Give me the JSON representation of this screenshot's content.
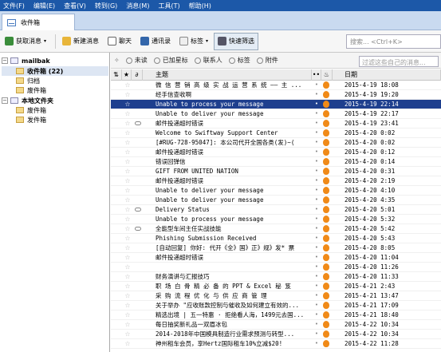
{
  "menu": [
    "文件(F)",
    "编辑(E)",
    "查看(V)",
    "转到(G)",
    "消息(M)",
    "工具(T)",
    "帮助(H)"
  ],
  "tab": {
    "label": "收件箱"
  },
  "toolbar": {
    "receive": "获取消息",
    "new": "新建消息",
    "chat": "聊天",
    "contacts": "通讯录",
    "tag": "标签",
    "quickfilter": "快速筛选",
    "search_placeholder": "搜索... <Ctrl+K>"
  },
  "tree": [
    {
      "label": "mailbak",
      "level": 0,
      "expander": "-",
      "bold": true
    },
    {
      "label": "收件箱 (22)",
      "level": 1,
      "bold": true,
      "selected": true
    },
    {
      "label": "归档",
      "level": 1
    },
    {
      "label": "废件箱",
      "level": 1
    },
    {
      "label": "本地文件夹",
      "level": 0,
      "expander": "-",
      "bold": true
    },
    {
      "label": "废件箱",
      "level": 1
    },
    {
      "label": "发件箱",
      "level": 1
    }
  ],
  "filters": {
    "unread": "未读",
    "starred": "已加星标",
    "contact": "联系人",
    "tags": "标签",
    "attachment": "附件",
    "filter_placeholder": "过滤这些自己的消息..."
  },
  "columns": {
    "subject": "主题",
    "date": "日期"
  },
  "messages": [
    {
      "subject": "微 信 营 销 高 级 实 战 运 营 系 统 —— 主 ...",
      "date": "2015-4-19 18:08",
      "att": false
    },
    {
      "subject": "经手信查收啊",
      "date": "2015-4-19 19:20",
      "att": false
    },
    {
      "subject": "Unable to process your message",
      "date": "2015-4-19 22:14",
      "att": false,
      "selected": true
    },
    {
      "subject": "Unable to deliver your message",
      "date": "2015-4-19 22:17",
      "att": false
    },
    {
      "subject": "邮件投递超时错误",
      "date": "2015-4-19 23:41",
      "att": true
    },
    {
      "subject": "Welcome to Swiftway Support Center",
      "date": "2015-4-20 0:02",
      "att": false
    },
    {
      "subject": "[#RUG-728-95047]: 本公司代开全国各类(发)~(",
      "date": "2015-4-20 0:02",
      "att": false
    },
    {
      "subject": "邮件投递超时错误",
      "date": "2015-4-20 0:12",
      "att": false
    },
    {
      "subject": "错误回弹信",
      "date": "2015-4-20 0:14",
      "att": false
    },
    {
      "subject": "GIFT FROM UNITED NATION",
      "date": "2015-4-20 0:31",
      "att": false
    },
    {
      "subject": "邮件投递超时错误",
      "date": "2015-4-20 2:19",
      "att": false
    },
    {
      "subject": "Unable to deliver your message",
      "date": "2015-4-20 4:10",
      "att": false
    },
    {
      "subject": "Unable to deliver your message",
      "date": "2015-4-20 4:35",
      "att": false
    },
    {
      "subject": "Delivery Status",
      "date": "2015-4-20 5:01",
      "att": true
    },
    {
      "subject": "Unable to process your message",
      "date": "2015-4-20 5:32",
      "att": false
    },
    {
      "subject": "全能型车间主任实战技能",
      "date": "2015-4-20 5:42",
      "att": true
    },
    {
      "subject": "Phishing Submission Received",
      "date": "2015-4-20 5:43",
      "att": false
    },
    {
      "subject": "[自动回复] 你好: 代开《全》国》正》规》发* 票",
      "date": "2015-4-20 8:05",
      "att": false
    },
    {
      "subject": "邮件投递超时错误",
      "date": "2015-4-20 11:04",
      "att": false
    },
    {
      "subject": "",
      "date": "2015-4-20 11:26",
      "att": false
    },
    {
      "subject": "财务演讲与汇报技巧",
      "date": "2015-4-20 11:33",
      "att": false
    },
    {
      "subject": "职 场 白 骨 精 必 备 的 PPT & Excel 秘 笈",
      "date": "2015-4-21 2:43",
      "att": false
    },
    {
      "subject": "采 购 流 程 优 化 与 供 应 商 管 理",
      "date": "2015-4-21 13:47",
      "att": false
    },
    {
      "subject": "关于举办 \"应收账款控制与催收及如何建立有效的...",
      "date": "2015-4-21 17:09",
      "att": false
    },
    {
      "subject": "精选出境 | 五一特惠 · 拒绝看人海，1499元去国...",
      "date": "2015-4-21 18:40",
      "att": false
    },
    {
      "subject": "每日抽奖新礼品一双眉冰包",
      "date": "2015-4-22 10:34",
      "att": false
    },
    {
      "subject": "2014-2018年中国模具制造行业需求预测与转型...",
      "date": "2015-4-22 10:34",
      "att": false
    },
    {
      "subject": "神州租车会员，享Hertz国际租车10%立减$20!",
      "date": "2015-4-22 11:28",
      "att": false
    }
  ]
}
